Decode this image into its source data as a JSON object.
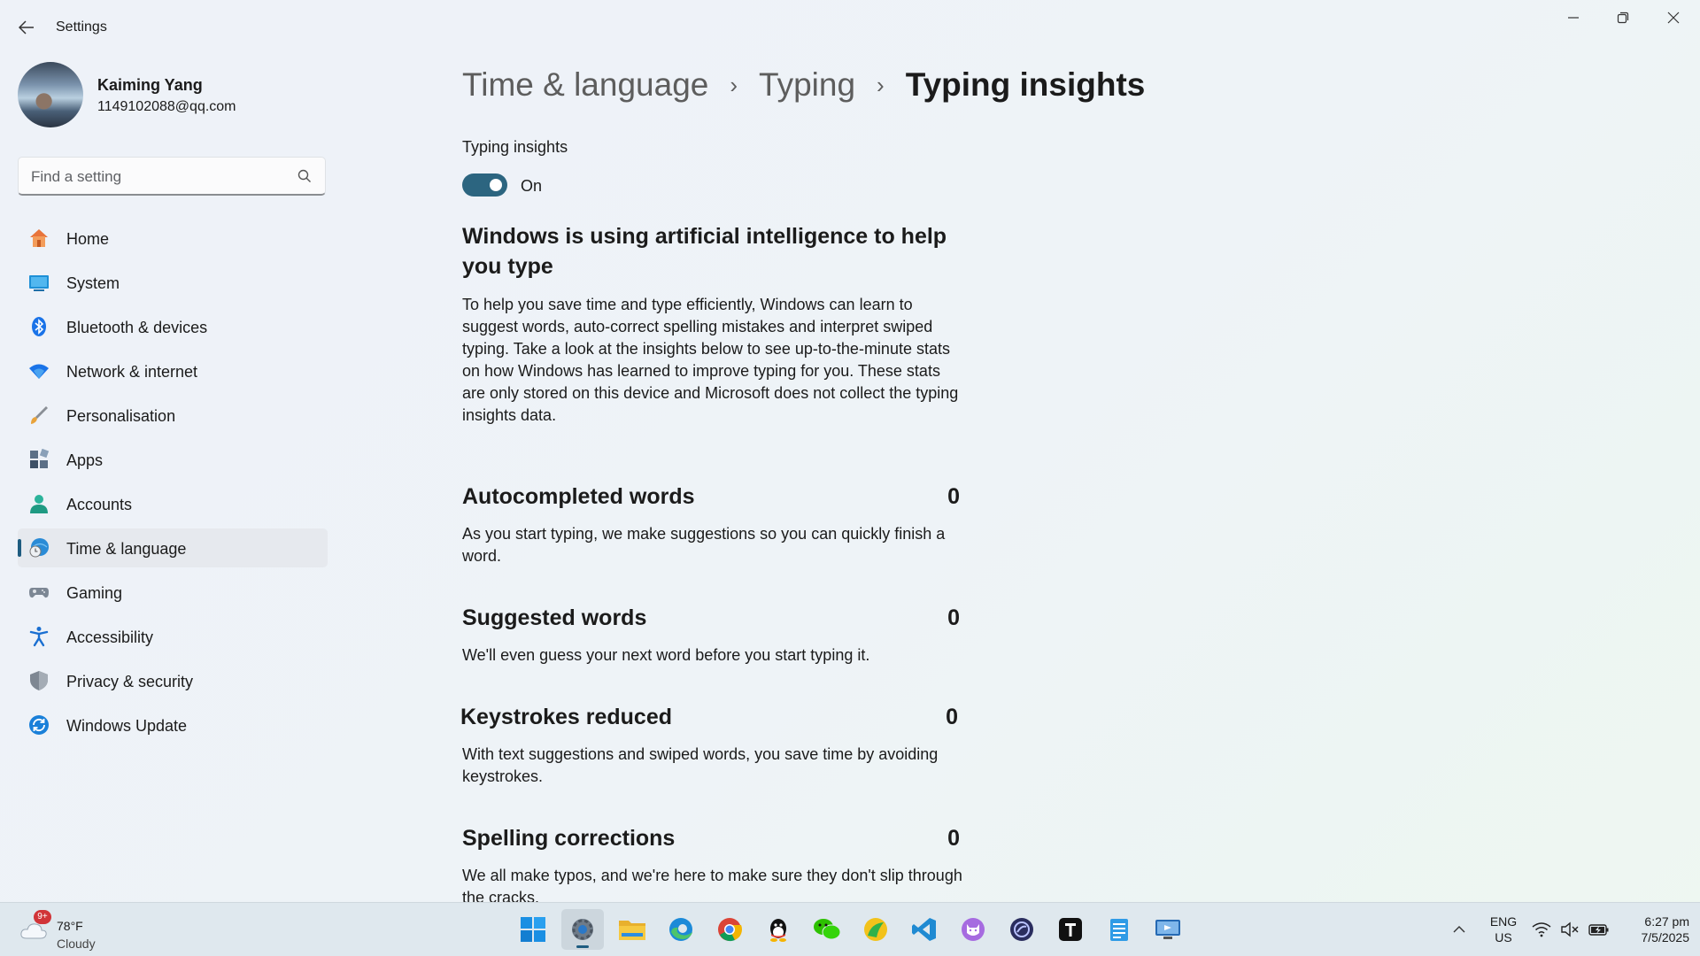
{
  "window": {
    "title": "Settings",
    "back_icon": "back-arrow-icon",
    "minimize_icon": "minimize-icon",
    "maximize_icon": "restore-icon",
    "close_icon": "close-icon"
  },
  "profile": {
    "name": "Kaiming Yang",
    "email": "1149102088@qq.com"
  },
  "search": {
    "placeholder": "Find a setting",
    "icon": "search-icon"
  },
  "sidebar": {
    "items": [
      {
        "label": "Home",
        "icon": "home-icon",
        "active": false
      },
      {
        "label": "System",
        "icon": "system-icon",
        "active": false
      },
      {
        "label": "Bluetooth & devices",
        "icon": "bluetooth-icon",
        "active": false
      },
      {
        "label": "Network & internet",
        "icon": "wifi-icon",
        "active": false
      },
      {
        "label": "Personalisation",
        "icon": "brush-icon",
        "active": false
      },
      {
        "label": "Apps",
        "icon": "apps-icon",
        "active": false
      },
      {
        "label": "Accounts",
        "icon": "accounts-icon",
        "active": false
      },
      {
        "label": "Time & language",
        "icon": "time-language-icon",
        "active": true
      },
      {
        "label": "Gaming",
        "icon": "gamepad-icon",
        "active": false
      },
      {
        "label": "Accessibility",
        "icon": "accessibility-icon",
        "active": false
      },
      {
        "label": "Privacy & security",
        "icon": "shield-icon",
        "active": false
      },
      {
        "label": "Windows Update",
        "icon": "update-icon",
        "active": false
      }
    ]
  },
  "breadcrumb": {
    "items": [
      "Time & language",
      "Typing",
      "Typing insights"
    ],
    "separator": "›"
  },
  "typing_insights": {
    "label": "Typing insights",
    "toggle_on": true,
    "toggle_state": "On"
  },
  "ai_section": {
    "heading": "Windows is using artificial intelligence to help you type",
    "body": "To help you save time and type efficiently, Windows can learn to suggest words, auto-correct spelling mistakes and interpret swiped typing. Take a look at the insights below to see up-to-the-minute stats on how Windows has learned to improve typing for you. These stats are only stored on this device and Microsoft does not collect the typing insights data."
  },
  "stats": [
    {
      "title": "Autocompleted words",
      "value": "0",
      "description": "As you start typing, we make suggestions so you can quickly finish a word."
    },
    {
      "title": "Suggested words",
      "value": "0",
      "description": "We'll even guess your next word before you start typing it."
    },
    {
      "title": "Keystrokes reduced",
      "value": "0",
      "description": "With text suggestions and swiped words, you save time by avoiding keystrokes."
    },
    {
      "title": "Spelling corrections",
      "value": "0",
      "description": "We all make typos, and we're here to make sure they don't slip through the cracks."
    }
  ],
  "taskbar": {
    "weather": {
      "badge": "9+",
      "temp": "78°F",
      "condition": "Cloudy",
      "icon": "cloud-icon"
    },
    "apps": [
      {
        "name": "start-icon",
        "active": false
      },
      {
        "name": "settings-icon",
        "active": true
      },
      {
        "name": "file-explorer-icon",
        "active": false
      },
      {
        "name": "edge-icon",
        "active": false
      },
      {
        "name": "chrome-icon",
        "active": false
      },
      {
        "name": "qq-icon",
        "active": false
      },
      {
        "name": "wechat-icon",
        "active": false
      },
      {
        "name": "green-app-icon",
        "active": false
      },
      {
        "name": "vscode-icon",
        "active": false
      },
      {
        "name": "cat-app-icon",
        "active": false
      },
      {
        "name": "circle-app-icon",
        "active": false
      },
      {
        "name": "typora-icon",
        "active": false
      },
      {
        "name": "notepad-icon",
        "active": false
      },
      {
        "name": "remote-desktop-icon",
        "active": false
      }
    ],
    "tray": {
      "lang_top": "ENG",
      "lang_bottom": "US",
      "time": "6:27 pm",
      "date": "7/5/2025"
    }
  },
  "colors": {
    "accent": "#2c6580",
    "active_bg": "#e6e9ee",
    "badge": "#d13438"
  }
}
